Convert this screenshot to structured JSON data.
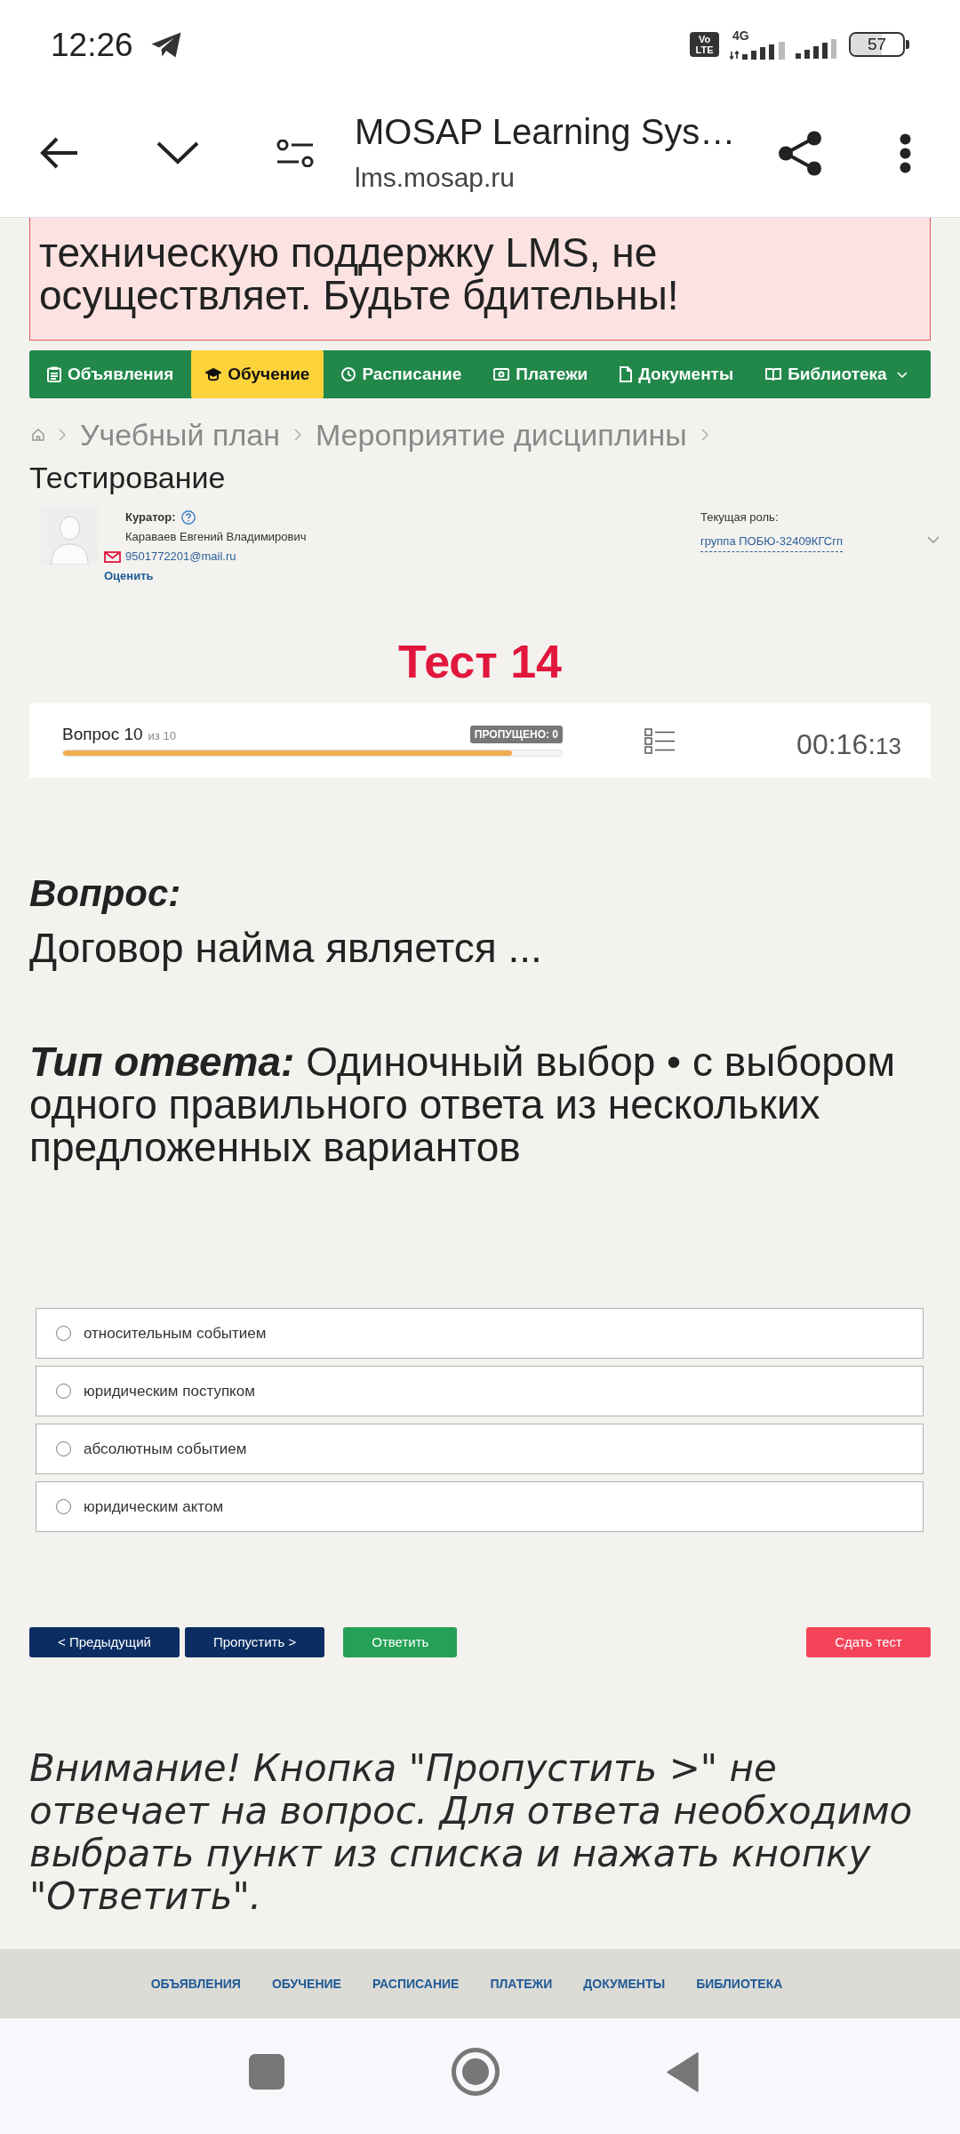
{
  "status_bar": {
    "time": "12:26",
    "volte": "Vo LTE",
    "network": "4G",
    "battery": "57"
  },
  "browser": {
    "title": "MOSAP Learning Sys…",
    "url": "lms.mosap.ru"
  },
  "alert": {
    "text": "техническую поддержку LMS, не осуществляет. Будьте бдительны!"
  },
  "nav": [
    {
      "label": "Объявления",
      "selected": false,
      "dropdown": false
    },
    {
      "label": "Обучение",
      "selected": true,
      "dropdown": false
    },
    {
      "label": "Расписание",
      "selected": false,
      "dropdown": false
    },
    {
      "label": "Платежи",
      "selected": false,
      "dropdown": false
    },
    {
      "label": "Документы",
      "selected": false,
      "dropdown": false
    },
    {
      "label": "Библиотека",
      "selected": false,
      "dropdown": true
    }
  ],
  "breadcrumb": [
    "Учебный план",
    "Мероприятие дисциплины"
  ],
  "page_title": "Тестирование",
  "curator": {
    "label": "Куратор:",
    "name": "Караваев Евгений Владимирович",
    "email": "9501772201@mail.ru",
    "rate_link": "Оценить"
  },
  "role": {
    "label": "Текущая роль:",
    "value": "группа ПОБЮ-32409КГСгп"
  },
  "test_title": "Тест 14",
  "progress": {
    "question": "Вопрос 10",
    "total": "из 10",
    "skipped": "ПРОПУЩЕНО: 0",
    "level": 0.9,
    "timer": {
      "main": "00:16:",
      "seconds": "13"
    }
  },
  "question": {
    "label": "Вопрос:",
    "text": "Договор найма является ..."
  },
  "answer_type": {
    "label": "Тип ответа:",
    "text": "Одиночный выбор • с выбором одного правильного ответа из нескольких предложенных вариантов"
  },
  "options": [
    {
      "label": "относительным событием",
      "selected": false
    },
    {
      "label": "юридическим поступком",
      "selected": false
    },
    {
      "label": "абсолютным событием",
      "selected": false
    },
    {
      "label": "юридическим актом",
      "selected": false
    }
  ],
  "buttons": [
    {
      "label": "< Предыдущий",
      "kind": "previous"
    },
    {
      "label": "Пропустить >",
      "kind": "skip"
    },
    {
      "label": "Ответить",
      "kind": "answer"
    },
    {
      "label": "Сдать тест",
      "kind": "finish"
    }
  ],
  "warning": "Внимание! Кнопка \"Пропустить >\" не отвечает на вопрос. Для ответа необходимо выбрать пункт из списка и нажать кнопку \"Ответить\".",
  "footer_links": [
    "ОБЪЯВЛЕНИЯ",
    "ОБУЧЕНИЕ",
    "РАСПИСАНИЕ",
    "ПЛАТЕЖИ",
    "ДОКУМЕНТЫ",
    "БИБЛИОТЕКА"
  ]
}
